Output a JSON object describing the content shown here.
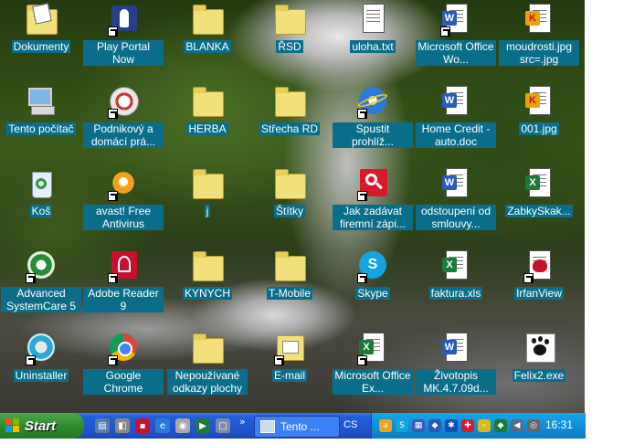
{
  "desktop": {
    "icons": [
      {
        "label": "Dokumenty"
      },
      {
        "label": "Play Portal Now"
      },
      {
        "label": "BLANKA"
      },
      {
        "label": "ŘSD"
      },
      {
        "label": "uloha.txt"
      },
      {
        "label": "Microsoft Office Wo..."
      },
      {
        "label": "moudrosti.jpg src=.jpg"
      },
      {
        "label": "Tento počítač"
      },
      {
        "label": "Podnikový a domácí prá..."
      },
      {
        "label": "HERBA"
      },
      {
        "label": "Střecha RD"
      },
      {
        "label": "Spustit prohlíž..."
      },
      {
        "label": "Home Credit -auto.doc"
      },
      {
        "label": "001.jpg"
      },
      {
        "label": "Koš"
      },
      {
        "label": "avast! Free Antivirus"
      },
      {
        "label": "j"
      },
      {
        "label": "Štítky"
      },
      {
        "label": "Jak zadávat firemní zápi..."
      },
      {
        "label": "odstoupení od smlouvy..."
      },
      {
        "label": "ZabkySkak..."
      },
      {
        "label": "Advanced SystemCare 5"
      },
      {
        "label": "Adobe Reader 9"
      },
      {
        "label": "KYNYCH"
      },
      {
        "label": "T-Mobile"
      },
      {
        "label": "Skype"
      },
      {
        "label": "faktura.xls"
      },
      {
        "label": "IrfanView"
      },
      {
        "label": "Uninstaller"
      },
      {
        "label": "Google Chrome"
      },
      {
        "label": "Nepoužívané odkazy plochy"
      },
      {
        "label": "E-mail"
      },
      {
        "label": "Microsoft Office Ex..."
      },
      {
        "label": "Životopis MK.4.7.09d..."
      },
      {
        "label": "Felix2.exe"
      }
    ]
  },
  "taskbar": {
    "start_label": "Start",
    "window_button_label": "Tento ...",
    "language": "CS",
    "chevron": "»",
    "clock": "16:31"
  },
  "colors": {
    "label_bg": "#0a6e8a",
    "taskbar": "#245edb",
    "tray": "#0f8fd8",
    "start": "#2e8b2e"
  }
}
